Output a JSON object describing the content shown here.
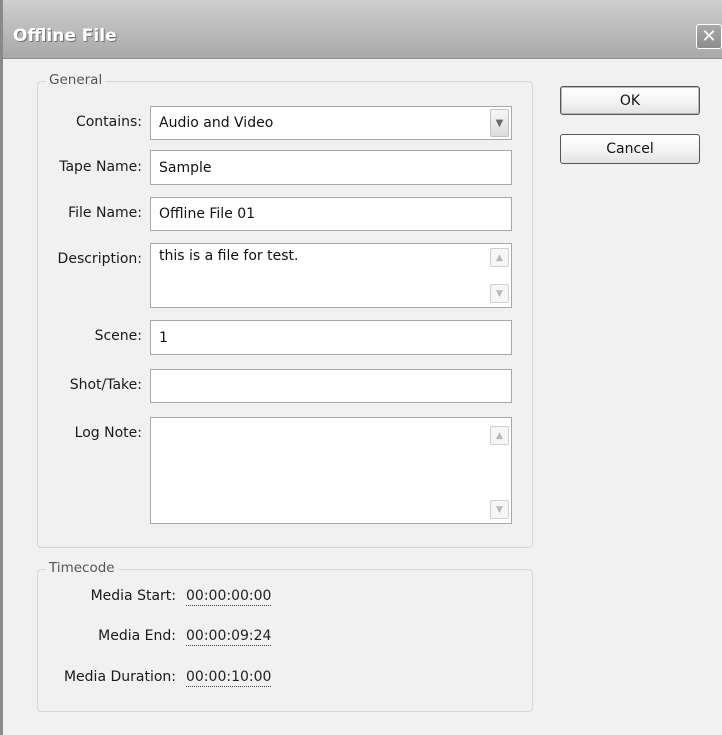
{
  "window": {
    "title": "Offline File"
  },
  "general": {
    "legend": "General",
    "contains": {
      "label": "Contains:",
      "value": "Audio and Video"
    },
    "tape_name": {
      "label": "Tape Name:",
      "value": "Sample"
    },
    "file_name": {
      "label": "File Name:",
      "value": "Offline File 01"
    },
    "description": {
      "label": "Description:",
      "value": "this is a file for test."
    },
    "scene": {
      "label": "Scene:",
      "value": "1"
    },
    "shot_take": {
      "label": "Shot/Take:",
      "value": ""
    },
    "log_note": {
      "label": "Log Note:",
      "value": ""
    }
  },
  "timecode": {
    "legend": "Timecode",
    "media_start": {
      "label": "Media Start:",
      "value": "00:00:00:00"
    },
    "media_end": {
      "label": "Media End:",
      "value": "00:00:09:24"
    },
    "media_duration": {
      "label": "Media Duration:",
      "value": "00:00:10:00"
    }
  },
  "buttons": {
    "ok": "OK",
    "cancel": "Cancel"
  },
  "icons": {
    "close": "close-icon",
    "dropdown": "chevron-down-icon",
    "scroll_up": "arrow-up-icon",
    "scroll_down": "arrow-down-icon"
  }
}
